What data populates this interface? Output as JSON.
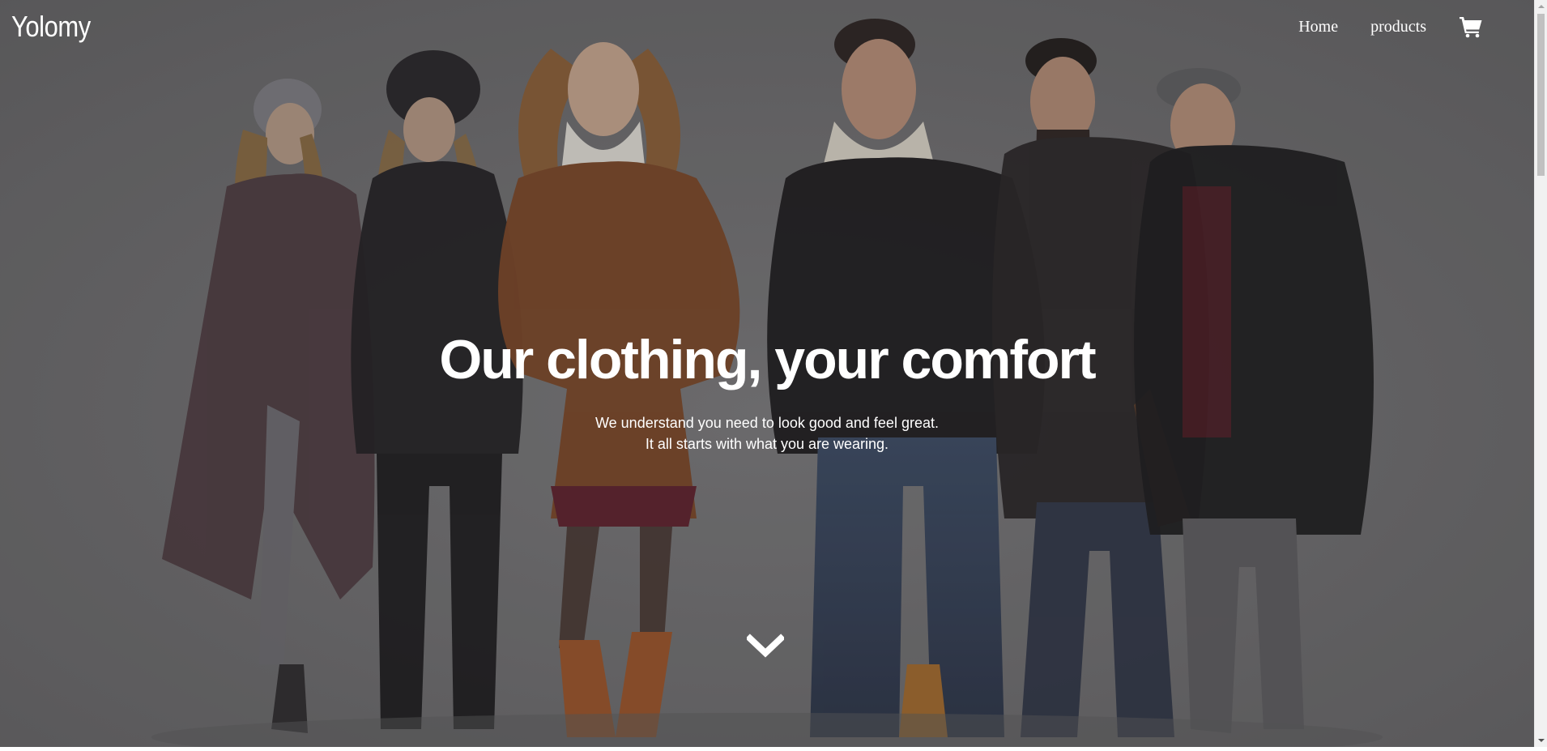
{
  "brand": {
    "name": "Yolomy"
  },
  "nav": {
    "items": [
      {
        "label": "Home",
        "icon": null
      },
      {
        "label": "products",
        "icon": null
      }
    ],
    "cart_icon": "shopping-cart-icon"
  },
  "hero": {
    "headline": "Our clothing, your comfort",
    "subline_1": "We understand you need to look good and feel great.",
    "subline_2": "It all starts with what you are wearing.",
    "scroll_icon": "chevron-down-icon",
    "background_image": "group of six people in winter coats, scarves and hats"
  },
  "colors": {
    "overlay": "#6b6a6b",
    "text": "#ffffff",
    "scrollbar_track": "#f1f1f1",
    "scrollbar_thumb": "#c1c1c1"
  }
}
